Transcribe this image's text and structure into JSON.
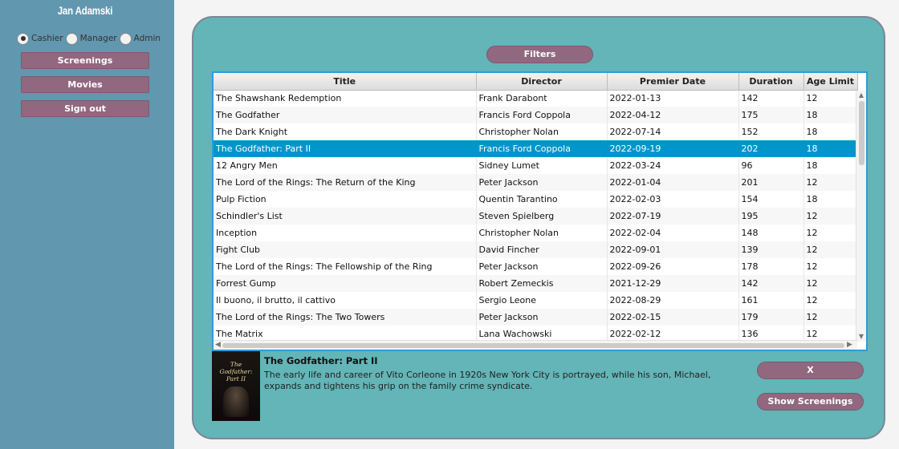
{
  "sidebar": {
    "username": "Jan Adamski",
    "roles": [
      {
        "label": "Cashier",
        "checked": true
      },
      {
        "label": "Manager",
        "checked": false
      },
      {
        "label": "Admin",
        "checked": false
      }
    ],
    "buttons": {
      "screenings": "Screenings",
      "movies": "Movies",
      "sign_out": "Sign out"
    }
  },
  "main": {
    "filters_label": "Filters",
    "table": {
      "columns": [
        "Title",
        "Director",
        "Premier Date",
        "Duration",
        "Age Limit"
      ],
      "rows": [
        [
          "The Shawshank Redemption",
          "Frank Darabont",
          "2022-01-13",
          "142",
          "12"
        ],
        [
          "The Godfather",
          "Francis Ford Coppola",
          "2022-04-12",
          "175",
          "18"
        ],
        [
          "The Dark Knight",
          "Christopher Nolan",
          "2022-07-14",
          "152",
          "18"
        ],
        [
          "The Godfather: Part II",
          "Francis Ford Coppola",
          "2022-09-19",
          "202",
          "18"
        ],
        [
          "12 Angry Men",
          "Sidney Lumet",
          "2022-03-24",
          "96",
          "18"
        ],
        [
          "The Lord of the Rings: The Return of the King",
          "Peter Jackson",
          "2022-01-04",
          "201",
          "12"
        ],
        [
          "Pulp Fiction",
          "Quentin Tarantino",
          "2022-02-03",
          "154",
          "18"
        ],
        [
          "Schindler's List",
          "Steven Spielberg",
          "2022-07-19",
          "195",
          "12"
        ],
        [
          "Inception",
          "Christopher Nolan",
          "2022-02-04",
          "148",
          "12"
        ],
        [
          "Fight Club",
          "David Fincher",
          "2022-09-01",
          "139",
          "12"
        ],
        [
          "The Lord of the Rings: The Fellowship of the Ring",
          "Peter Jackson",
          "2022-09-26",
          "178",
          "12"
        ],
        [
          "Forrest Gump",
          "Robert Zemeckis",
          "2021-12-29",
          "142",
          "12"
        ],
        [
          "Il buono, il brutto, il cattivo",
          "Sergio Leone",
          "2022-08-29",
          "161",
          "12"
        ],
        [
          "The Lord of the Rings: The Two Towers",
          "Peter Jackson",
          "2022-02-15",
          "179",
          "12"
        ],
        [
          "The Matrix",
          "Lana Wachowski",
          "2022-02-12",
          "136",
          "12"
        ]
      ],
      "selected_row": 3
    },
    "detail": {
      "poster_icon": "movie-poster-image",
      "title": "The Godfather: Part II",
      "description": "The early life and career of Vito Corleone in 1920s New York City is portrayed, while his son, Michael, expands and tightens his grip on the family crime syndicate.",
      "close_label": "X",
      "show_screenings_label": "Show Screenings"
    }
  },
  "colors": {
    "sidebar_bg": "#6197af",
    "panel_bg": "#63b5b7",
    "button_bg": "#91687f",
    "selection": "#0096c9"
  }
}
